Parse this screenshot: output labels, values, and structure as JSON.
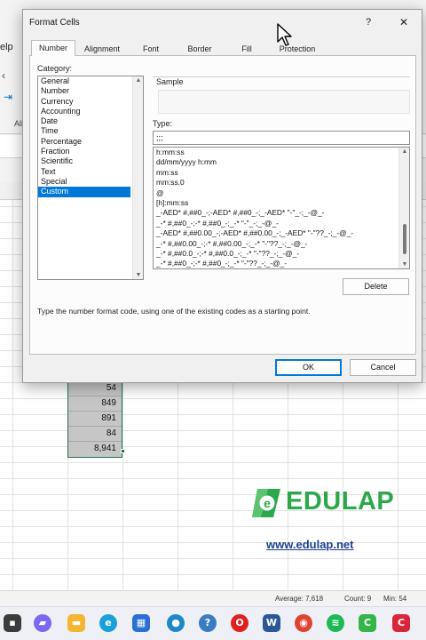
{
  "excel": {
    "ribbon_tab_partial": "elp",
    "ribbon_label_partial": "Ali",
    "selected_values": [
      "54",
      "849",
      "891",
      "84",
      "8,941"
    ],
    "status": {
      "average": "Average: 7,618",
      "count": "Count: 9",
      "min": "Min: 54"
    }
  },
  "watermark": {
    "brand": "EDULAP",
    "url": "www.edulap.net"
  },
  "dialog": {
    "title": "Format Cells",
    "help_label": "?",
    "close_label": "✕",
    "tabs": [
      "Number",
      "Alignment",
      "Font",
      "Border",
      "Fill",
      "Protection"
    ],
    "active_tab": "Number",
    "category_label": "Category:",
    "categories": [
      "General",
      "Number",
      "Currency",
      "Accounting",
      "Date",
      "Time",
      "Percentage",
      "Fraction",
      "Scientific",
      "Text",
      "Special",
      "Custom"
    ],
    "selected_category": "Custom",
    "sample_label": "Sample",
    "type_label": "Type:",
    "type_value": ";;;",
    "type_list": [
      "h:mm:ss",
      "dd/mm/yyyy h:mm",
      "mm:ss",
      "mm:ss.0",
      "@",
      "[h]:mm:ss",
      "_-AED* #,##0_-;-AED* #,##0_-;_-AED* \"-\"_-;_-@_-",
      "_-* #,##0_-;-* #,##0_-;_-* \"-\"_-;_-@_-",
      "_-AED* #,##0.00_-;-AED* #,##0.00_-;_-AED* \"-\"??_-;_-@_-",
      "_-* #,##0.00_-;-* #,##0.00_-;_-* \"-\"??_-;_-@_-",
      "_-* #,##0.0_-;-* #,##0.0_-;_-* \"-\"??_-;_-@_-",
      "_-* #,##0_-;-* #,##0_-;_-* \"-\"??_-;_-@_-"
    ],
    "delete_label": "Delete",
    "hint": "Type the number format code, using one of the existing codes as a starting point.",
    "ok_label": "OK",
    "cancel_label": "Cancel"
  },
  "taskbar": {
    "apps": [
      "start",
      "chat",
      "file-explorer",
      "edge",
      "microsoft-store",
      "app-icon",
      "python",
      "opera",
      "word",
      "chrome",
      "spotify",
      "camtasia",
      "screen-recorder"
    ]
  },
  "colors": {
    "accent": "#0078d7",
    "excel_green": "#217346",
    "edulap_green": "#2aa84a",
    "edulap_blue": "#1b3f8f"
  }
}
